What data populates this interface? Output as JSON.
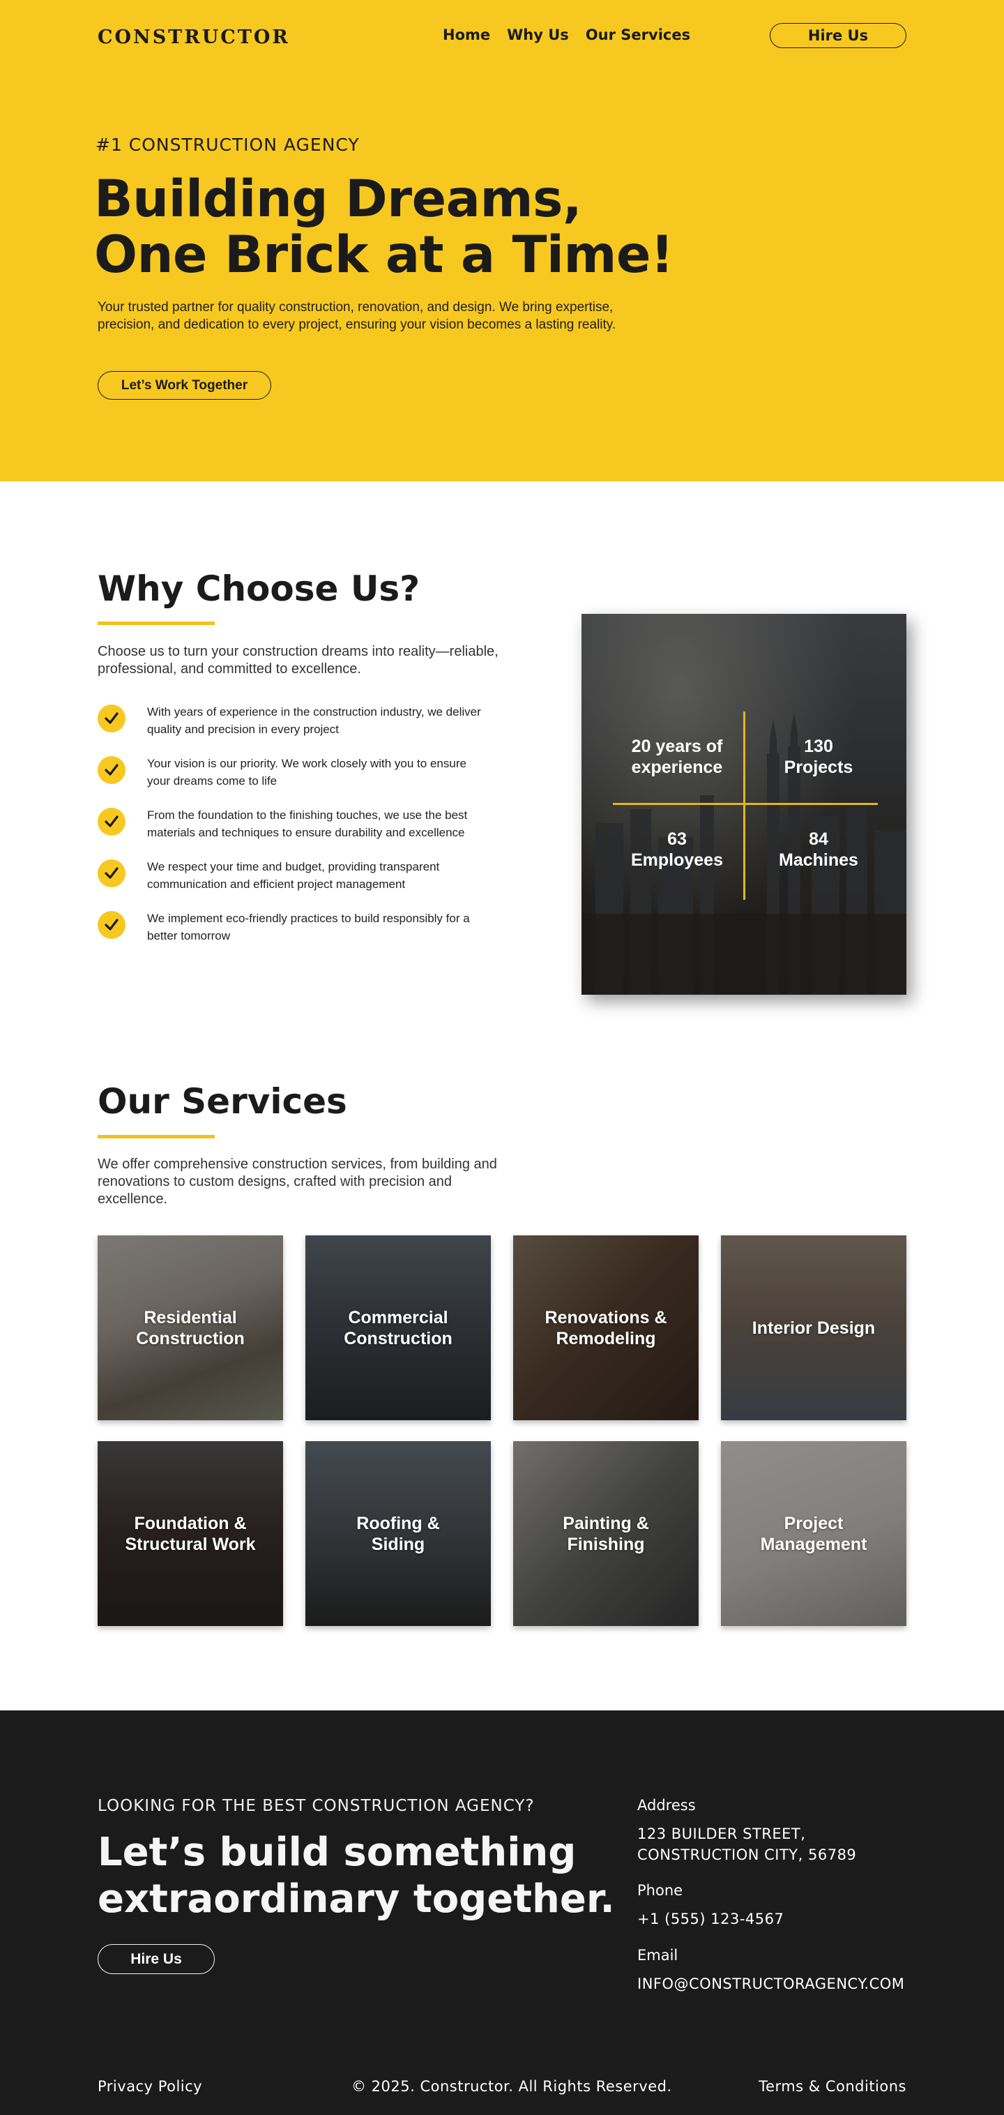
{
  "header": {
    "logo": "CONSTRUCTOR",
    "nav": [
      "Home",
      "Why Us",
      "Our Services"
    ],
    "hire_label": "Hire Us"
  },
  "hero": {
    "eyebrow": "#1 CONSTRUCTION AGENCY",
    "title_line1": "Building Dreams,",
    "title_line2": "One Brick at a Time!",
    "subtitle": "Your trusted partner for quality construction, renovation, and design. We bring expertise, precision, and dedication to every project, ensuring your vision becomes a lasting reality.",
    "cta_label": "Let’s Work Together"
  },
  "why": {
    "title": "Why Choose Us?",
    "subtitle": "Choose us to turn your construction dreams into reality—reliable, professional, and committed to excellence.",
    "items": [
      "With years of experience in the construction industry, we deliver quality and precision in every project",
      "Your vision is our priority. We work closely with you to ensure your dreams come to life",
      "From the foundation to the finishing touches, we use the best materials and techniques to ensure durability and excellence",
      "We respect your time and budget, providing transparent communication and efficient project management",
      "We implement eco-friendly practices to build responsibly for a better tomorrow"
    ],
    "stats": [
      {
        "line1": "20 years of",
        "line2": "experience"
      },
      {
        "line1": "130",
        "line2": "Projects"
      },
      {
        "line1": "63",
        "line2": "Employees"
      },
      {
        "line1": "84",
        "line2": "Machines"
      }
    ]
  },
  "services": {
    "title": "Our Services",
    "subtitle": "We offer comprehensive construction services, from building and renovations to custom designs, crafted with precision and excellence.",
    "items": [
      {
        "line1": "Residential",
        "line2": "Construction"
      },
      {
        "line1": "Commercial",
        "line2": "Construction"
      },
      {
        "line1": "Renovations &",
        "line2": "Remodeling"
      },
      {
        "line1": "Interior Design",
        "line2": ""
      },
      {
        "line1": "Foundation &",
        "line2": "Structural Work"
      },
      {
        "line1": "Roofing &",
        "line2": "Siding"
      },
      {
        "line1": "Painting &",
        "line2": "Finishing"
      },
      {
        "line1": "Project",
        "line2": "Management"
      }
    ]
  },
  "footer": {
    "eyebrow": "LOOKING FOR THE BEST CONSTRUCTION AGENCY?",
    "title_line1": "Let’s build something",
    "title_line2": "extraordinary together.",
    "cta_label": "Hire Us",
    "address_label": "Address",
    "address_line1": "123 BUILDER STREET,",
    "address_line2": "CONSTRUCTION CITY, 56789",
    "phone_label": "Phone",
    "phone": "+1 (555) 123-4567",
    "email_label": "Email",
    "email": "INFO@CONSTRUCTORAGENCY.COM",
    "privacy": "Privacy Policy",
    "copyright": "© 2025. Constructor. All Rights Reserved.",
    "terms": "Terms & Conditions"
  },
  "colors": {
    "accent": "#f7c820",
    "dark": "#1b1b1b",
    "white": "#ffffff"
  }
}
